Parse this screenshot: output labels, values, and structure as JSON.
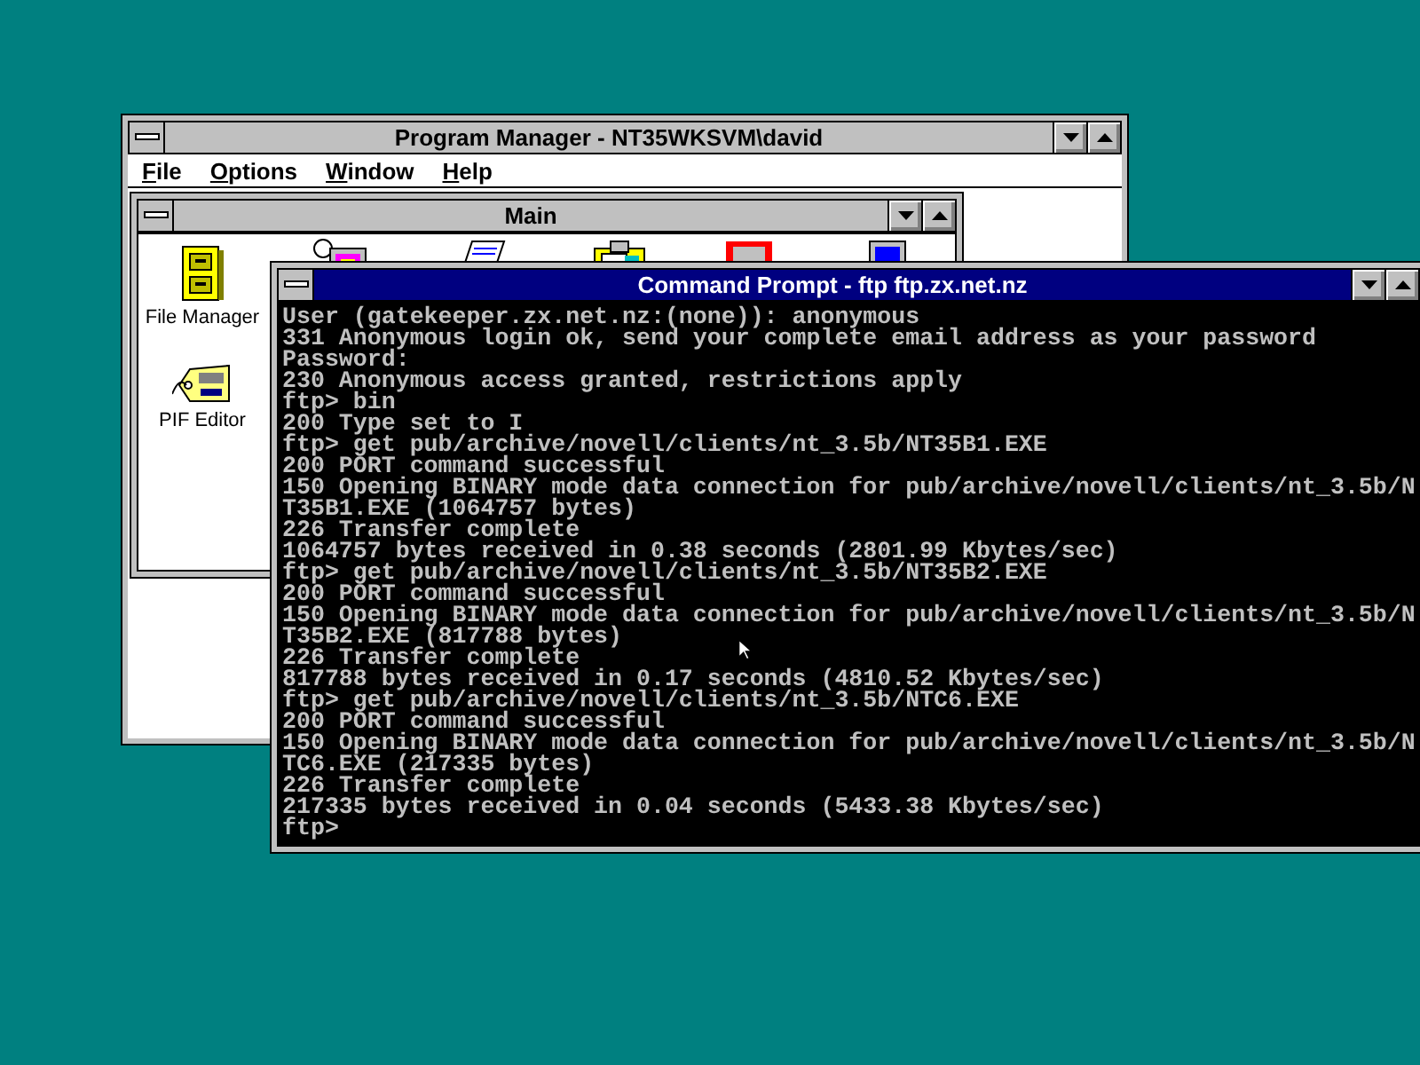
{
  "program_manager": {
    "title": "Program Manager - NT35WKSVM\\david",
    "active": false,
    "menu": [
      "File",
      "Options",
      "Window",
      "Help"
    ],
    "group": {
      "title": "Main",
      "icons": [
        {
          "label": "File Manager",
          "kind": "cabinet"
        },
        {
          "label": "PIF Editor",
          "kind": "tag"
        }
      ]
    }
  },
  "command_prompt": {
    "title": "Command Prompt - ftp ftp.zx.net.nz",
    "active": true,
    "lines": [
      "User (gatekeeper.zx.net.nz:(none)): anonymous",
      "331 Anonymous login ok, send your complete email address as your password",
      "Password:",
      "230 Anonymous access granted, restrictions apply",
      "ftp> bin",
      "200 Type set to I",
      "ftp> get pub/archive/novell/clients/nt_3.5b/NT35B1.EXE",
      "200 PORT command successful",
      "150 Opening BINARY mode data connection for pub/archive/novell/clients/nt_3.5b/N",
      "T35B1.EXE (1064757 bytes)",
      "226 Transfer complete",
      "1064757 bytes received in 0.38 seconds (2801.99 Kbytes/sec)",
      "ftp> get pub/archive/novell/clients/nt_3.5b/NT35B2.EXE",
      "200 PORT command successful",
      "150 Opening BINARY mode data connection for pub/archive/novell/clients/nt_3.5b/N",
      "T35B2.EXE (817788 bytes)",
      "226 Transfer complete",
      "817788 bytes received in 0.17 seconds (4810.52 Kbytes/sec)",
      "ftp> get pub/archive/novell/clients/nt_3.5b/NTC6.EXE",
      "200 PORT command successful",
      "150 Opening BINARY mode data connection for pub/archive/novell/clients/nt_3.5b/N",
      "TC6.EXE (217335 bytes)",
      "226 Transfer complete",
      "217335 bytes received in 0.04 seconds (5433.38 Kbytes/sec)",
      "ftp>"
    ]
  }
}
